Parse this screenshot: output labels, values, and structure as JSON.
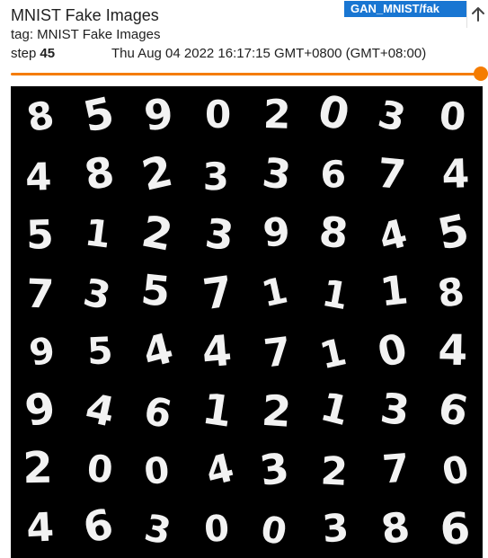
{
  "card": {
    "title": "MNIST Fake Images",
    "run_label": "GAN_MNIST/fak",
    "pin_icon": "arrow-up-icon",
    "tag_line": "tag: MNIST Fake Images",
    "step_label": "step",
    "step_value": "45",
    "timestamp": "Thu Aug 04 2022 16:17:15 GMT+0800 (GMT+08:00)",
    "slider_fraction": 1.0,
    "slider_color": "#f57c00",
    "badge_color": "#1976d2"
  },
  "image_grid": {
    "rows": [
      [
        "8",
        "5",
        "9",
        "0",
        "2",
        "0",
        "3",
        "0"
      ],
      [
        "4",
        "8",
        "2",
        "3",
        "3",
        "6",
        "7",
        "4"
      ],
      [
        "5",
        "1",
        "2",
        "3",
        "9",
        "8",
        "4",
        "5"
      ],
      [
        "7",
        "3",
        "5",
        "7",
        "1",
        "1",
        "1",
        "8"
      ],
      [
        "9",
        "5",
        "4",
        "4",
        "7",
        "1",
        "0",
        "4"
      ],
      [
        "9",
        "4",
        "6",
        "1",
        "2",
        "1",
        "3",
        "6"
      ],
      [
        "2",
        "0",
        "0",
        "4",
        "3",
        "2",
        "7",
        "0"
      ],
      [
        "4",
        "6",
        "3",
        "0",
        "0",
        "3",
        "8",
        "6"
      ]
    ]
  }
}
